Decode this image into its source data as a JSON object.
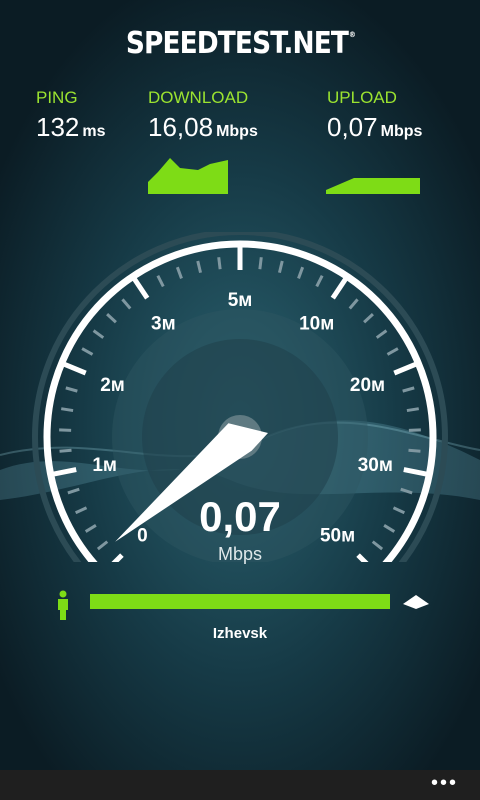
{
  "app": {
    "logo": "SPEEDTEST.NET",
    "logo_mark": "®"
  },
  "metrics": {
    "ping": {
      "label": "PING",
      "value": "132",
      "unit": "ms"
    },
    "download": {
      "label": "DOWNLOAD",
      "value": "16,08",
      "unit": "Mbps"
    },
    "upload": {
      "label": "UPLOAD",
      "value": "0,07",
      "unit": "Mbps"
    }
  },
  "gauge": {
    "ticks": [
      "0",
      "1м",
      "2м",
      "3м",
      "5м",
      "10м",
      "20м",
      "30м",
      "50м"
    ],
    "needle_value": 0.07,
    "readout": "0,07",
    "readout_unit": "Mbps"
  },
  "progress": {
    "fraction": 1.0,
    "server": "Izhevsk"
  },
  "colors": {
    "accent": "#7edc16",
    "background": "#0b1c24"
  },
  "icons": {
    "user": "person-icon",
    "server": "server-icon",
    "more": "more-icon"
  },
  "appbar": {
    "more": "•••"
  }
}
